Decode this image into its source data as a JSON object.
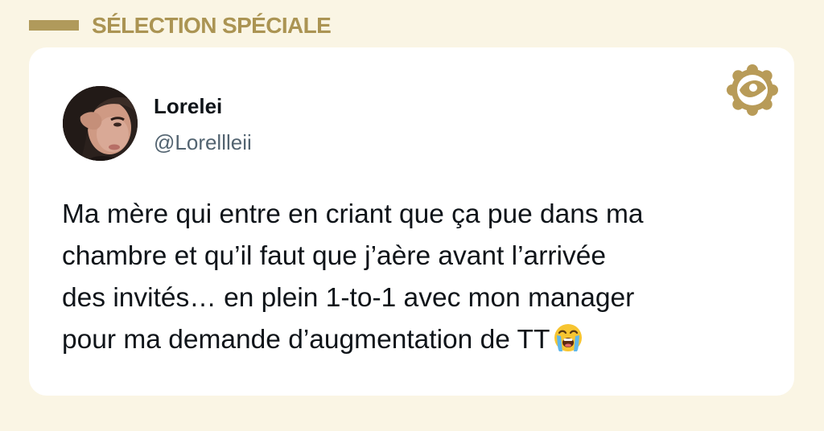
{
  "header": {
    "label": "SÉLECTION SPÉCIALE",
    "accent_color": "#b09a5b"
  },
  "tweet": {
    "author": {
      "name": "Lorelei",
      "handle": "@Lorellleii",
      "avatar": "profile-photo"
    },
    "lines": [
      "Ma mère qui entre en criant que ça pue dans ma",
      "chambre et qu’il faut que j’aère avant l’arrivée",
      "des invités… en plein 1-to-1 avec mon manager",
      "pour ma demande d’augmentation de TT"
    ],
    "emoji": "loudly-crying-face-icon"
  },
  "brand": {
    "icon": "brand-seal-eye-icon",
    "color": "#b89b58"
  }
}
